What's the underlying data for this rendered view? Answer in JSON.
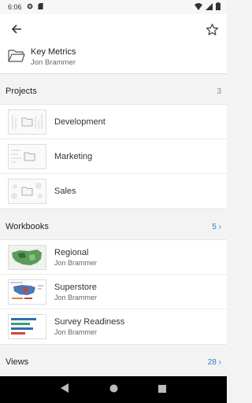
{
  "status_bar": {
    "time": "6:06"
  },
  "header": {
    "title": "Key Metrics",
    "subtitle": "Jon Brammer"
  },
  "projects": {
    "title": "Projects",
    "count": "3",
    "items": [
      {
        "label": "Development"
      },
      {
        "label": "Marketing"
      },
      {
        "label": "Sales"
      }
    ]
  },
  "workbooks": {
    "title": "Workbooks",
    "count": "5 ›",
    "items": [
      {
        "title": "Regional",
        "owner": "Jon Brammer"
      },
      {
        "title": "Superstore",
        "owner": "Jon Brammer"
      },
      {
        "title": "Survey Readiness",
        "owner": "Jon Brammer"
      }
    ]
  },
  "views": {
    "title": "Views",
    "count": "28 ›"
  },
  "colors": {
    "link": "#2a7ad4",
    "background": "#f3f3f3"
  }
}
